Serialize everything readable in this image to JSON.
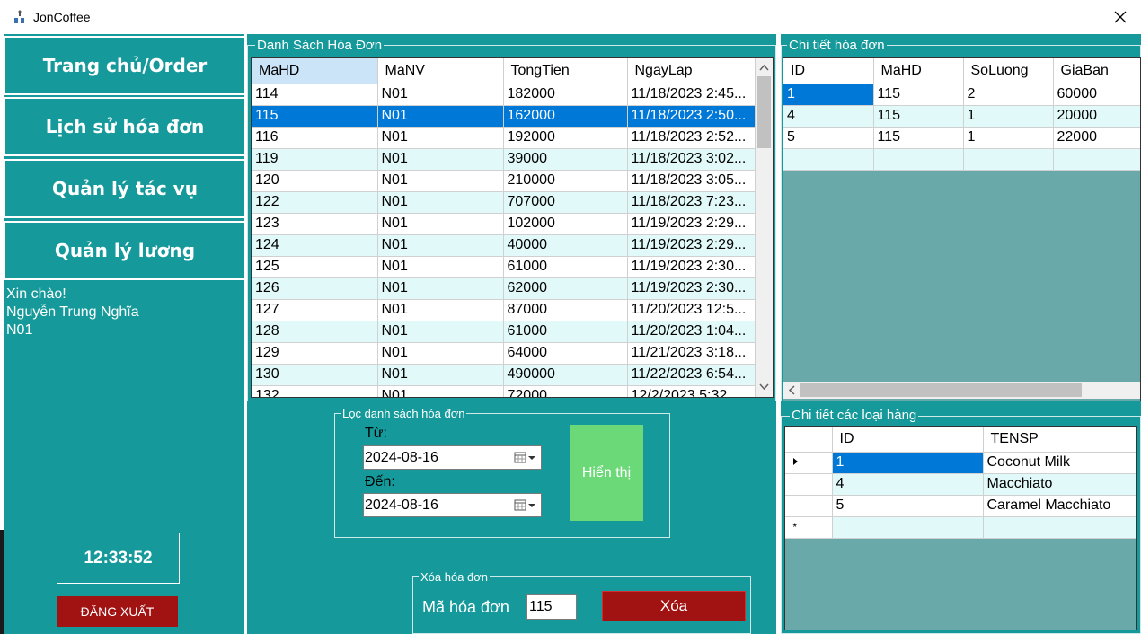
{
  "window": {
    "title": "JonCoffee",
    "close_icon": "close-icon",
    "app_icon": "app-icon"
  },
  "sidebar": {
    "items": [
      {
        "label": "Trang chủ/Order"
      },
      {
        "label": "Lịch sử hóa đơn"
      },
      {
        "label": "Quản lý tác vụ"
      },
      {
        "label": "Quản lý lương"
      }
    ],
    "greeting": "Xin chào!",
    "user_name": "Nguyễn Trung Nghĩa",
    "user_id": "N01",
    "clock": "12:33:52",
    "logout_label": "ĐĂNG XUẤT"
  },
  "invoices": {
    "group_title": "Danh Sách Hóa Đơn",
    "columns": [
      "MaHD",
      "MaNV",
      "TongTien",
      "NgayLap"
    ],
    "rows": [
      [
        "114",
        "N01",
        "182000",
        "11/18/2023 2:45..."
      ],
      [
        "115",
        "N01",
        "162000",
        "11/18/2023 2:50..."
      ],
      [
        "116",
        "N01",
        "192000",
        "11/18/2023 2:52..."
      ],
      [
        "119",
        "N01",
        "39000",
        "11/18/2023 3:02..."
      ],
      [
        "120",
        "N01",
        "210000",
        "11/18/2023 3:05..."
      ],
      [
        "122",
        "N01",
        "707000",
        "11/18/2023 7:23..."
      ],
      [
        "123",
        "N01",
        "102000",
        "11/19/2023 2:29..."
      ],
      [
        "124",
        "N01",
        "40000",
        "11/19/2023 2:29..."
      ],
      [
        "125",
        "N01",
        "61000",
        "11/19/2023 2:30..."
      ],
      [
        "126",
        "N01",
        "62000",
        "11/19/2023 2:30..."
      ],
      [
        "127",
        "N01",
        "87000",
        "11/20/2023 12:5..."
      ],
      [
        "128",
        "N01",
        "61000",
        "11/20/2023 1:04..."
      ],
      [
        "129",
        "N01",
        "64000",
        "11/21/2023 3:18..."
      ],
      [
        "130",
        "N01",
        "490000",
        "11/22/2023 6:54..."
      ],
      [
        "132",
        "N01",
        "72000",
        "12/2/2023 5:32..."
      ]
    ]
  },
  "invoice_detail": {
    "group_title": "Chi tiết hóa đơn",
    "columns": [
      "ID",
      "MaHD",
      "SoLuong",
      "GiaBan"
    ],
    "rows": [
      [
        "1",
        "115",
        "2",
        "60000"
      ],
      [
        "4",
        "115",
        "1",
        "20000"
      ],
      [
        "5",
        "115",
        "1",
        "22000"
      ]
    ]
  },
  "filter": {
    "group_title": "Lọc danh sách hóa đơn",
    "from_label": "Từ:",
    "from_value": "2024-08-16",
    "to_label": "Đến:",
    "to_value": "2024-08-16",
    "show_label": "Hiển thị"
  },
  "delete": {
    "group_title": "Xóa hóa đơn",
    "label": "Mã hóa đơn",
    "value": "115",
    "button_label": "Xóa"
  },
  "products": {
    "group_title": "Chi tiết các loại hàng",
    "columns": [
      "ID",
      "TENSP"
    ],
    "rows": [
      [
        "1",
        "Coconut Milk"
      ],
      [
        "4",
        "Macchiato"
      ],
      [
        "5",
        "Caramel Macchiato"
      ]
    ]
  },
  "colors": {
    "teal": "#15999a",
    "grid_bg": "#6aa9a9",
    "selection": "#0078d7",
    "alt_row": "#e2f9f9",
    "danger": "#a11212",
    "show_button": "#6bd977"
  }
}
